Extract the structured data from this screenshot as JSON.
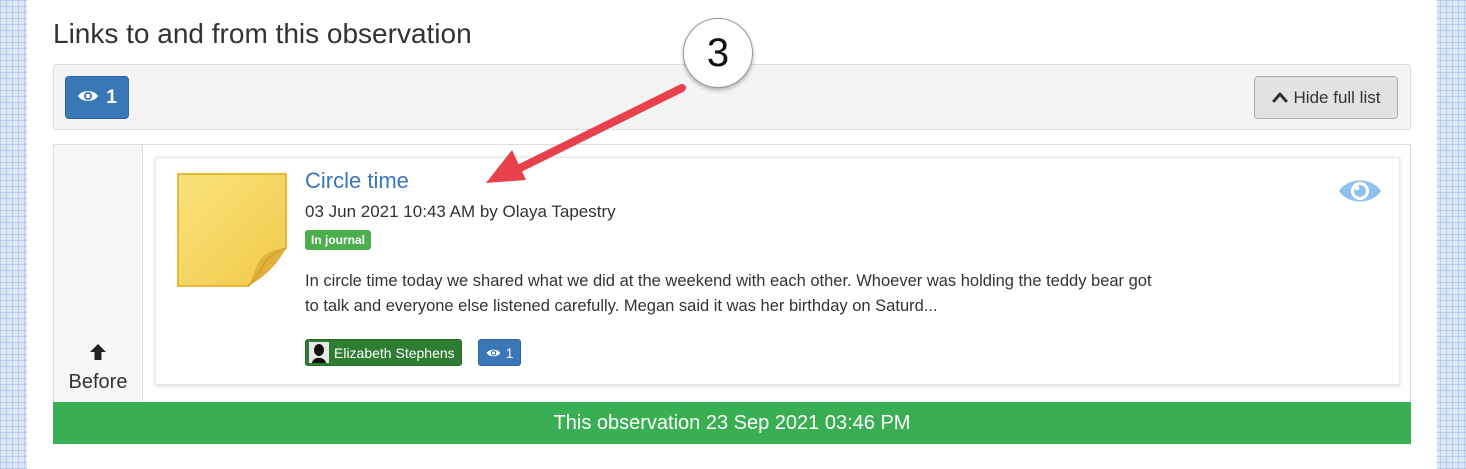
{
  "section": {
    "title": "Links to and from this observation"
  },
  "toolbar": {
    "views_count": "1",
    "hide_label": "Hide full list"
  },
  "before": {
    "label": "Before"
  },
  "linked_observation": {
    "title": "Circle time",
    "meta": "03 Jun 2021 10:43 AM by Olaya Tapestry",
    "badge": "In journal",
    "text": "In circle time today we shared what we did at the weekend with each other. Whoever was holding the teddy bear got to talk and everyone else listened carefully. Megan said it was her birthday on Saturd...",
    "child_name": "Elizabeth Stephens",
    "views_count": "1"
  },
  "current_observation": {
    "label": "This observation 23 Sep 2021 03:46 PM"
  },
  "annotation": {
    "step_number": "3"
  },
  "colors": {
    "primary": "#3a77b7",
    "success": "#3aae52",
    "child_tag": "#2e7d32",
    "badge": "#4cae4c",
    "link": "#3a77b7",
    "annotation_arrow": "#e8414b"
  },
  "icons": {
    "views": "eye-icon",
    "hide": "chevron-up-icon",
    "before": "arrow-up-icon",
    "thumbnail": "sticky-note-icon",
    "card_view": "eye-icon"
  }
}
